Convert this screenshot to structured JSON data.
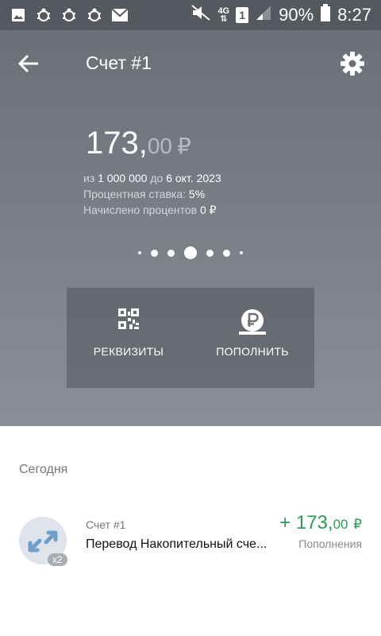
{
  "status_bar": {
    "network": "4G",
    "sim": "1",
    "battery": "90%",
    "time": "8:27",
    "icons": [
      "image-icon",
      "bug-icon",
      "bug-icon",
      "bug-icon",
      "mail-icon",
      "mute-icon",
      "signal-icon",
      "battery-icon"
    ]
  },
  "header": {
    "title": "Счет #1",
    "amount_main": "173,",
    "amount_cents": "00",
    "currency": "₽",
    "info_from": "из",
    "info_goal": "1 000 000",
    "info_until": "до",
    "info_date": "6 окт. 2023",
    "rate_label": "Процентная ставка:",
    "rate_value": "5%",
    "interest_label": "Начислено процентов",
    "interest_value": "0 ₽",
    "pager": {
      "count": 7,
      "active_index": 3
    }
  },
  "actions": {
    "details_label": "РЕКВИЗИТЫ",
    "topup_label": "ПОПОЛНИТЬ"
  },
  "history": {
    "section_label": "Сегодня",
    "items": [
      {
        "account": "Счет #1",
        "title": "Перевод Накопительный сче...",
        "amount_main": "+ 173,",
        "amount_cents": "00",
        "currency": "₽",
        "type": "Пополнения",
        "badge": "x2"
      }
    ]
  },
  "colors": {
    "header_top": "#6b7078",
    "header_bottom": "#8a8f96",
    "status_bar": "#55595f",
    "positive_amount": "#2a9c55",
    "avatar_bg": "#dfe4ec",
    "avatar_arrow": "#6f9fc9"
  }
}
